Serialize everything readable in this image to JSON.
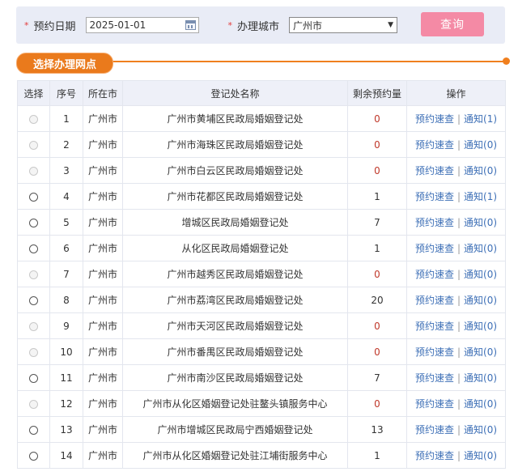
{
  "search": {
    "date_label": "预约日期",
    "date_value": "2025-01-01",
    "city_label": "办理城市",
    "city_value": "广州市",
    "query_button": "查询"
  },
  "section_title": "选择办理网点",
  "columns": [
    "选择",
    "序号",
    "所在市",
    "登记处名称",
    "剩余预约量",
    "操作"
  ],
  "rows": [
    {
      "enabled": false,
      "no": "1",
      "city": "广州市",
      "name": "广州市黄埔区民政局婚姻登记处",
      "remain": "0",
      "action": "预约速查",
      "notice": "通知(1)"
    },
    {
      "enabled": false,
      "no": "2",
      "city": "广州市",
      "name": "广州市海珠区民政局婚姻登记处",
      "remain": "0",
      "action": "预约速查",
      "notice": "通知(0)"
    },
    {
      "enabled": false,
      "no": "3",
      "city": "广州市",
      "name": "广州市白云区民政局婚姻登记处",
      "remain": "0",
      "action": "预约速查",
      "notice": "通知(0)"
    },
    {
      "enabled": true,
      "no": "4",
      "city": "广州市",
      "name": "广州市花都区民政局婚姻登记处",
      "remain": "1",
      "action": "预约速查",
      "notice": "通知(1)"
    },
    {
      "enabled": true,
      "no": "5",
      "city": "广州市",
      "name": "增城区民政局婚姻登记处",
      "remain": "7",
      "action": "预约速查",
      "notice": "通知(0)"
    },
    {
      "enabled": true,
      "no": "6",
      "city": "广州市",
      "name": "从化区民政局婚姻登记处",
      "remain": "1",
      "action": "预约速查",
      "notice": "通知(0)"
    },
    {
      "enabled": false,
      "no": "7",
      "city": "广州市",
      "name": "广州市越秀区民政局婚姻登记处",
      "remain": "0",
      "action": "预约速查",
      "notice": "通知(0)"
    },
    {
      "enabled": true,
      "no": "8",
      "city": "广州市",
      "name": "广州市荔湾区民政局婚姻登记处",
      "remain": "20",
      "action": "预约速查",
      "notice": "通知(0)"
    },
    {
      "enabled": false,
      "no": "9",
      "city": "广州市",
      "name": "广州市天河区民政局婚姻登记处",
      "remain": "0",
      "action": "预约速查",
      "notice": "通知(0)"
    },
    {
      "enabled": false,
      "no": "10",
      "city": "广州市",
      "name": "广州市番禺区民政局婚姻登记处",
      "remain": "0",
      "action": "预约速查",
      "notice": "通知(0)"
    },
    {
      "enabled": true,
      "no": "11",
      "city": "广州市",
      "name": "广州市南沙区民政局婚姻登记处",
      "remain": "7",
      "action": "预约速查",
      "notice": "通知(0)"
    },
    {
      "enabled": false,
      "no": "12",
      "city": "广州市",
      "name": "广州市从化区婚姻登记处驻鳌头镇服务中心",
      "remain": "0",
      "action": "预约速查",
      "notice": "通知(0)"
    },
    {
      "enabled": true,
      "no": "13",
      "city": "广州市",
      "name": "广州市增城区民政局宁西婚姻登记处",
      "remain": "13",
      "action": "预约速查",
      "notice": "通知(0)"
    },
    {
      "enabled": true,
      "no": "14",
      "city": "广州市",
      "name": "广州市从化区婚姻登记处驻江埔街服务中心",
      "remain": "1",
      "action": "预约速查",
      "notice": "通知(0)"
    }
  ],
  "colors": {
    "accent_orange": "#ea7a1c",
    "query_pink": "#f48aa5",
    "link_blue": "#3d6fb6",
    "zero_red": "#c0392b"
  }
}
